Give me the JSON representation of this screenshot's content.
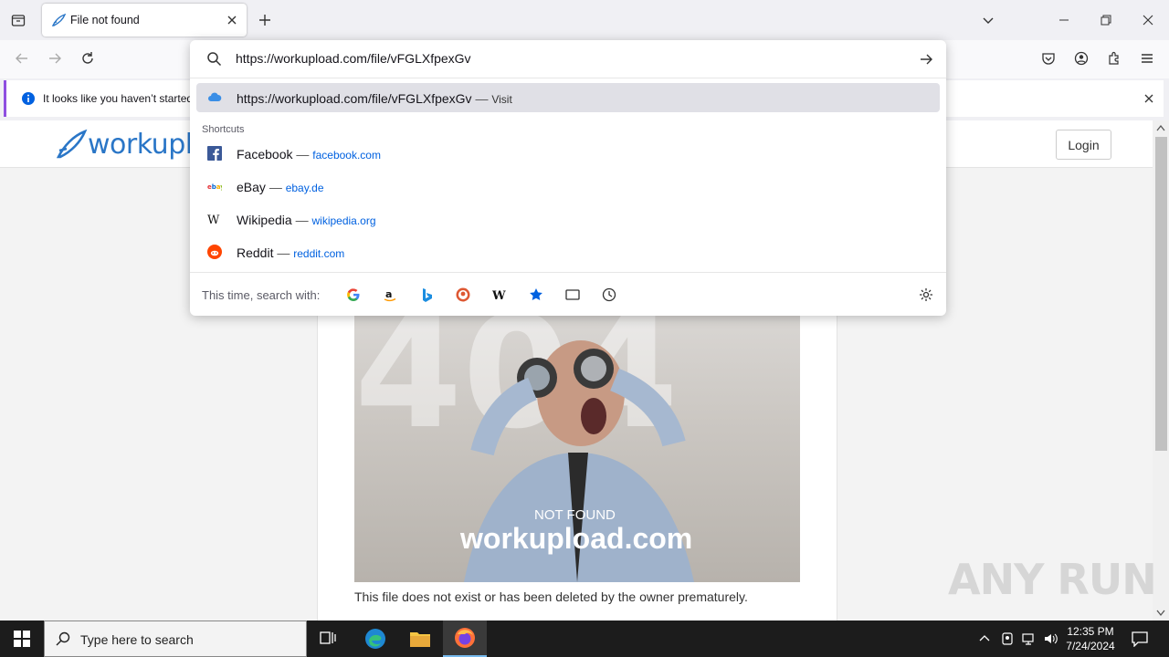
{
  "browser": {
    "tab": {
      "title": "File not found"
    },
    "notification": {
      "text": "It looks like you haven’t started"
    }
  },
  "site": {
    "logo": "workuplo",
    "login_label": "Login",
    "image": {
      "overlay_small": "NOT FOUND",
      "overlay_big": "workupload.com",
      "bg_digits": "404"
    },
    "description": "This file does not exist or has been deleted by the owner prematurely."
  },
  "urlbar": {
    "input_value": "https://workupload.com/file/vFGLXfpexGv",
    "visit_row": {
      "url": "https://workupload.com/file/vFGLXfpexGv",
      "sep": "—",
      "action": "Visit"
    },
    "shortcuts_label": "Shortcuts",
    "shortcuts": [
      {
        "name": "Facebook",
        "sep": "—",
        "url": "facebook.com",
        "icon": "facebook-icon"
      },
      {
        "name": "eBay",
        "sep": "—",
        "url": "ebay.de",
        "icon": "ebay-icon"
      },
      {
        "name": "Wikipedia",
        "sep": "—",
        "url": "wikipedia.org",
        "icon": "wikipedia-icon"
      },
      {
        "name": "Reddit",
        "sep": "—",
        "url": "reddit.com",
        "icon": "reddit-icon"
      }
    ],
    "search_with_label": "This time, search with:",
    "engines": [
      "google",
      "amazon",
      "bing",
      "duckduckgo",
      "wikipedia",
      "bookmarks",
      "tabs",
      "history"
    ]
  },
  "taskbar": {
    "search_placeholder": "Type here to search",
    "time": "12:35 PM",
    "date": "7/24/2024"
  },
  "watermark": "ANY RUN",
  "colors": {
    "accent": "#0061e0",
    "notif_border": "#8f4fe0",
    "logo": "#2a76c7"
  }
}
